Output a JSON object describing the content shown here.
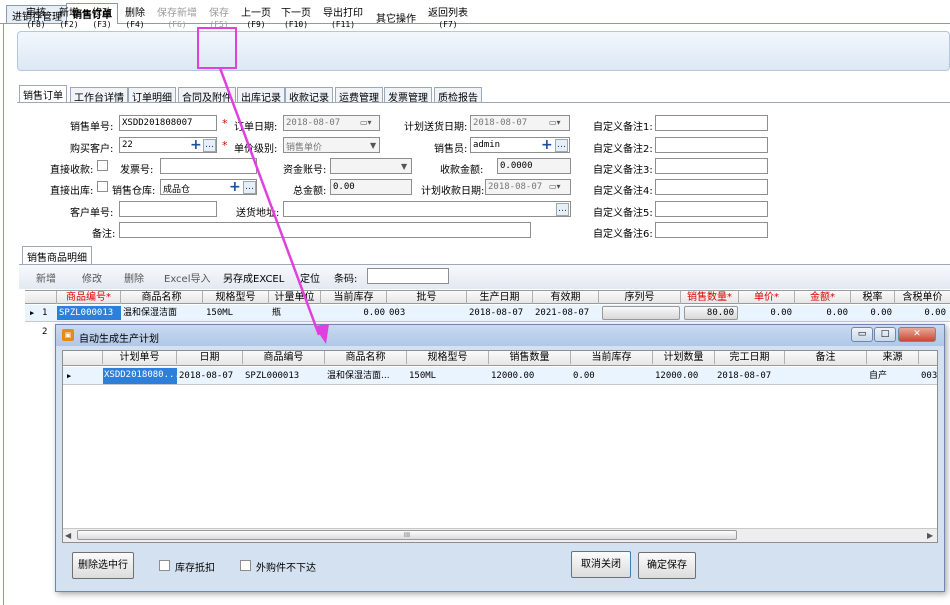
{
  "top_tabs": [
    "进销存管理",
    "销售订单"
  ],
  "toolbar": [
    {
      "label": "审核",
      "key": "(F8)",
      "enabled": true
    },
    {
      "label": "新增",
      "key": "(F2)",
      "enabled": true
    },
    {
      "label": "修改",
      "key": "(F3)",
      "enabled": true
    },
    {
      "label": "删除",
      "key": "(F4)",
      "enabled": true
    },
    {
      "label": "保存新增",
      "key": "(F6)",
      "enabled": false
    },
    {
      "label": "保存",
      "key": "(F5)",
      "enabled": false
    },
    {
      "label": "上一页",
      "key": "(F9)",
      "enabled": true
    },
    {
      "label": "下一页",
      "key": "(F10)",
      "enabled": true
    },
    {
      "label": "导出打印",
      "key": "(F11)",
      "enabled": true
    },
    {
      "label": "其它操作",
      "key": "",
      "enabled": true
    },
    {
      "label": "返回列表",
      "key": "(F7)",
      "enabled": true
    }
  ],
  "sub_tabs": [
    "销售订单",
    "工作台详情",
    "订单明细",
    "合同及附件",
    "出库记录",
    "收款记录",
    "运费管理",
    "发票管理",
    "质检报告"
  ],
  "form": {
    "order_no_label": "销售单号:",
    "order_no": "XSDD201808007",
    "order_date_label": "订单日期:",
    "order_date": "2018-08-07",
    "plan_ship_label": "计划送货日期:",
    "plan_ship": "2018-08-07",
    "custom1_label": "自定义备注1:",
    "customer_label": "购买客户:",
    "customer": "22",
    "price_level_label": "单价级别:",
    "price_level": "销售单价",
    "salesman_label": "销售员:",
    "salesman": "admin",
    "custom2_label": "自定义备注2:",
    "direct_receive_label": "直接收款:",
    "invoice_no_label": "发票号:",
    "fund_account_label": "资金账号:",
    "receive_amount_label": "收款金额:",
    "receive_amount": "0.0000",
    "custom3_label": "自定义备注3:",
    "direct_out_label": "直接出库:",
    "warehouse_label": "销售仓库:",
    "warehouse": "成品仓",
    "total_label": "总金额:",
    "total": "0.00",
    "plan_receive_label": "计划收款日期:",
    "plan_receive": "2018-08-07",
    "custom4_label": "自定义备注4:",
    "customer_order_label": "客户单号:",
    "address_label": "送货地址:",
    "custom5_label": "自定义备注5:",
    "remark_label": "备注:",
    "custom6_label": "自定义备注6:"
  },
  "detail": {
    "tab": "销售商品明细",
    "buttons": [
      "新增",
      "修改",
      "删除",
      "Excel导入",
      "另存成EXCEL",
      "定位"
    ],
    "barcode_label": "条码:",
    "headers": [
      "商品编号*",
      "商品名称",
      "规格型号",
      "计量单位",
      "当前库存",
      "批号",
      "生产日期",
      "有效期",
      "序列号",
      "销售数量*",
      "单价*",
      "金额*",
      "税率",
      "含税单价"
    ],
    "row": {
      "no": "1",
      "code": "SPZL000013",
      "name": "温和保湿洁面",
      "spec": "150ML",
      "unit": "瓶",
      "stock": "0.00",
      "batch": "003",
      "mfg": "2018-08-07",
      "exp": "2021-08-07",
      "qty": "80.00",
      "price": "0.00",
      "amount": "0.00",
      "tax": "0.00",
      "tax_price": "0.00"
    },
    "row2_no": "2"
  },
  "dialog": {
    "title": "自动生成生产计划",
    "win_buttons": [
      "▭",
      "□",
      "✕"
    ],
    "headers": [
      "计划单号",
      "日期",
      "商品编号",
      "商品名称",
      "规格型号",
      "销售数量",
      "当前库存",
      "计划数量",
      "完工日期",
      "备注",
      "来源"
    ],
    "row": {
      "plan_no": "XSDD2018080...",
      "date": "2018-08-07",
      "code": "SPZL000013",
      "name": "温和保湿洁面...",
      "spec": "150ML",
      "qty": "12000.00",
      "stock": "0.00",
      "plan_qty": "12000.00",
      "finish": "2018-08-07",
      "remark": "",
      "source": "自产",
      "extra": "003"
    },
    "scroll_grip": "III",
    "delete_btn": "删除选中行",
    "stock_offset": "库存抵扣",
    "outsourcing": "外购件不下达",
    "cancel_btn": "取消关闭",
    "confirm_btn": "确定保存"
  },
  "colors": {
    "highlight": "#e040e0",
    "accent": "#2d7fd9",
    "row_bg": "#eaf4ff"
  }
}
